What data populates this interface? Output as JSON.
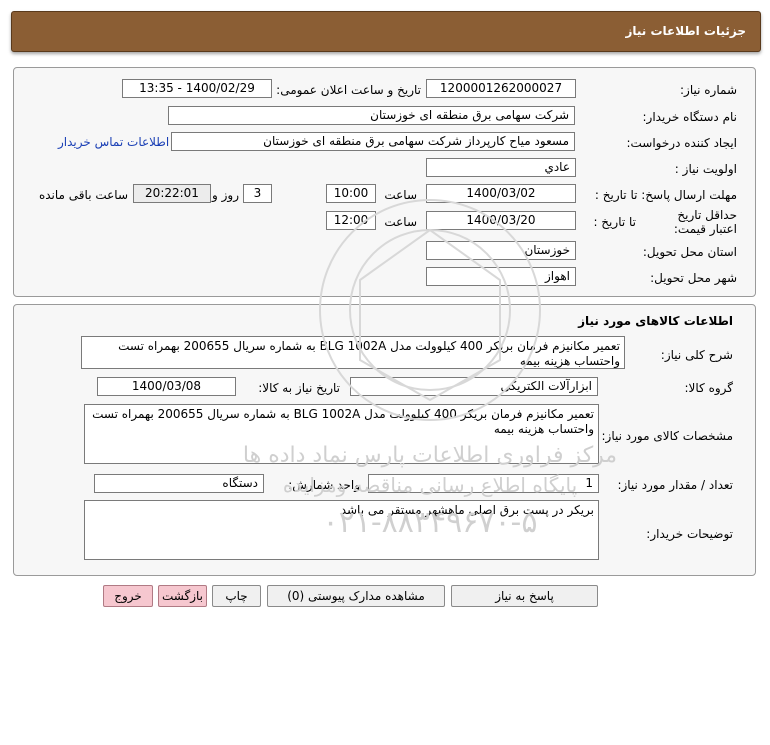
{
  "header": {
    "title": "جزئیات اطلاعات نیاز"
  },
  "info": {
    "need_number_label": "شماره نیاز:",
    "need_number": "1200001262000027",
    "announce_label": "تاریخ و ساعت اعلان عمومی:",
    "announce_value": "1400/02/29 - 13:35",
    "buyer_org_label": "نام دستگاه خریدار:",
    "buyer_org": "شرکت سهامی برق منطقه ای خوزستان",
    "creator_label": "ایجاد کننده درخواست:",
    "creator": "مسعود میاح کارپرداز شرکت سهامی برق منطقه ای خوزستان",
    "contact_link": "اطلاعات تماس خریدار",
    "priority_label": "اولویت نیاز :",
    "priority": "عادي",
    "deadline_label": "مهلت ارسال پاسخ: تا تاریخ :",
    "deadline_date": "1400/03/02",
    "hour_label": "ساعت",
    "deadline_time": "10:00",
    "days_count": "3",
    "days_label": "روز و",
    "remaining_time": "20:22:01",
    "remaining_label": "ساعت باقی مانده",
    "validity_label": "حداقل تاریخ اعتبار قیمت:",
    "validity_to_label": "تا تاریخ :",
    "validity_date": "1400/03/20",
    "validity_hour_label": "ساعت",
    "validity_time": "12:00",
    "province_label": "استان محل تحویل:",
    "province": "خوزستان",
    "city_label": "شهر محل تحویل:",
    "city": "اهواز"
  },
  "goods": {
    "section_title": "اطلاعات کالاهای مورد نیاز",
    "summary_label": "شرح کلی نیاز:",
    "summary": "تعمیر مکانیزم فرمان بریکر 400 کیلوولت مدل BLG 1002A به شماره سریال 200655 بهمراه تست واحتساب هزینه بیمه",
    "group_label": "گروه کالا:",
    "group": "ابزارآلات الکتریکی",
    "need_date_label": "تاریخ نیاز به کالا:",
    "need_date": "1400/03/08",
    "spec_label": "مشخصات کالای مورد نیاز:",
    "spec": "تعمیر مکانیزم فرمان بریکر 400 کیلوولت مدل BLG 1002A به شماره سریال 200655 بهمراه تست واحتساب هزینه بیمه",
    "qty_label": "تعداد / مقدار مورد نیاز:",
    "qty": "1",
    "unit_label": "واحد شمارش:",
    "unit": "دستگاه",
    "notes_label": "توضیحات خریدار:",
    "notes": "بریکر در پست برق اصلی ماهشهر مستقر می باشد"
  },
  "buttons": {
    "reply": "پاسخ به نیاز",
    "attachments": "مشاهده مدارک پیوستی (0)",
    "print": "چاپ",
    "back": "بازگشت",
    "exit": "خروج"
  },
  "watermark": {
    "line1": "مرکز فراوری اطلاعات پارس نماد داده ها",
    "line2": "پایگاه اطلاع رسانی مناقصه ومزایده",
    "phone": "۰۲۱-۸۸۳۴۹۶۷۰-۵"
  }
}
